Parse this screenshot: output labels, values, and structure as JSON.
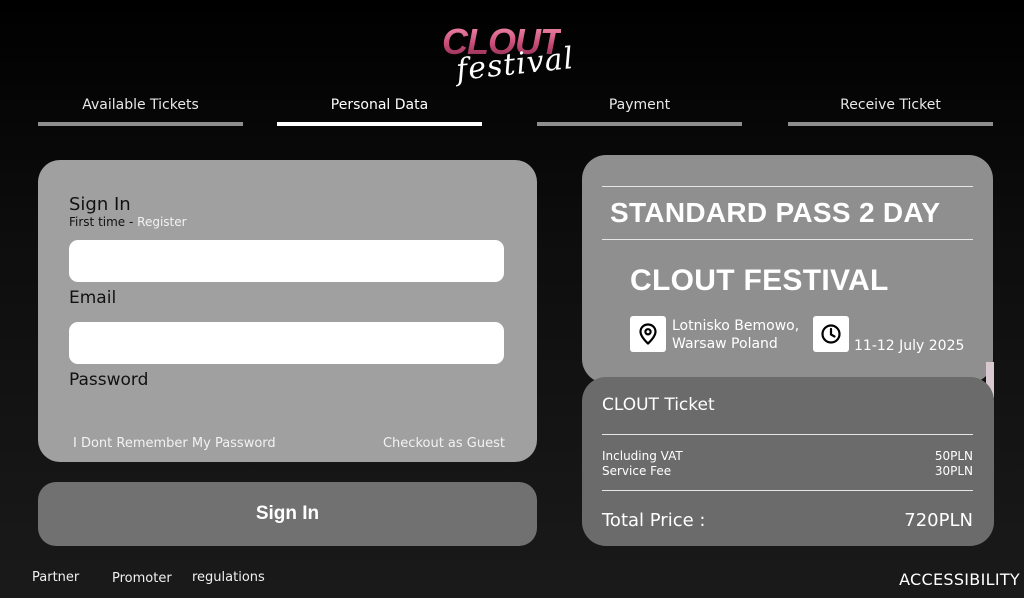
{
  "logo": {
    "brand": "CLOUT",
    "script": "festival",
    "accent_color": "#d4577f"
  },
  "steps": [
    {
      "label": "Available Tickets",
      "active": false
    },
    {
      "label": "Personal Data",
      "active": true
    },
    {
      "label": "Payment",
      "active": false
    },
    {
      "label": "Receive Ticket",
      "active": false
    }
  ],
  "signin": {
    "title": "Sign In",
    "first_time": "First time - ",
    "register": "Register",
    "email_label": "Email",
    "email_value": "",
    "password_label": "Password",
    "password_value": "",
    "forgot": "I Dont Remember My Password",
    "guest": "Checkout as Guest",
    "button": "Sign In"
  },
  "ticket": {
    "pass_name": "STANDARD PASS 2 DAY",
    "event_name": "CLOUT FESTIVAL",
    "location_line1": "Lotnisko Bemowo,",
    "location_line2": "Warsaw Poland",
    "date": "11-12 July 2025",
    "location_icon": "map-pin-icon",
    "date_icon": "clock-icon"
  },
  "price": {
    "title": "CLOUT Ticket",
    "vat_label": "Including VAT",
    "vat_value": "50PLN",
    "fee_label": "Service Fee",
    "fee_value": "30PLN",
    "total_label": "Total Price :",
    "total_value": "720PLN"
  },
  "footer": {
    "partner": "Partner",
    "promoter": "Promoter",
    "regulations": "regulations",
    "accessibility": "ACCESSIBILITY"
  }
}
